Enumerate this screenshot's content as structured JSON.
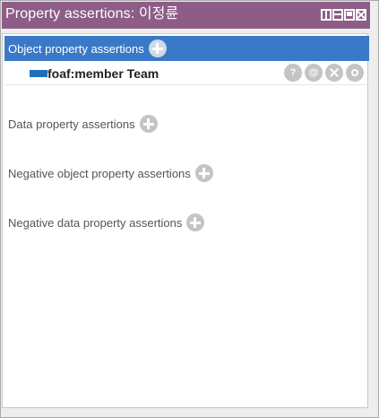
{
  "window": {
    "title": "Property assertions: 이정륜",
    "controls": [
      "split-vertical-icon",
      "split-horizontal-icon",
      "maximize-icon",
      "close-icon"
    ]
  },
  "sections": {
    "object": {
      "label": "Object property assertions",
      "selected": true
    },
    "data": {
      "label": "Data property assertions"
    },
    "negative_object": {
      "label": "Negative object property assertions"
    },
    "negative_data": {
      "label": "Negative data property assertions"
    }
  },
  "object_assertions": [
    {
      "property": "foaf:member",
      "value": "Team",
      "text": "foaf:member  Team"
    }
  ],
  "row_actions": {
    "annotate": "?",
    "explain": "@"
  },
  "colors": {
    "title_bar": "#8d5d87",
    "selection": "#3a78c8",
    "object_property_swatch": "#1f6fbd",
    "button_grey": "#c4c4c4"
  }
}
